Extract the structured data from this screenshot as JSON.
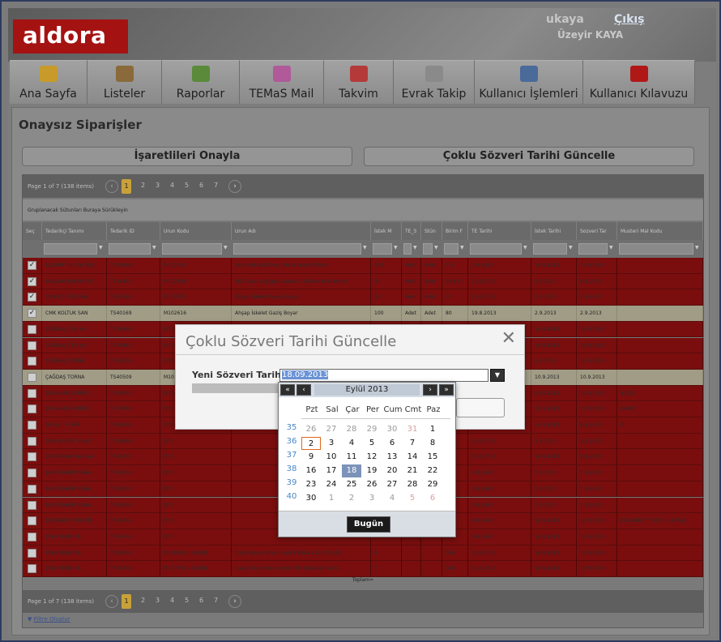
{
  "header": {
    "logo": "aldora",
    "user": "ukaya",
    "logout": "Çıkış",
    "full_name": "Üzeyir KAYA"
  },
  "nav": [
    {
      "label": "Ana Sayfa",
      "icon": "home-icon",
      "color": "#c79a2a"
    },
    {
      "label": "Listeler",
      "icon": "signpost-icon",
      "color": "#8a6a3a"
    },
    {
      "label": "Raporlar",
      "icon": "bar-chart-icon",
      "color": "#5a8a3a"
    },
    {
      "label": "TEMaS Mail",
      "icon": "mail-icon",
      "color": "#b05a9a"
    },
    {
      "label": "Takvim",
      "icon": "calendar-icon",
      "color": "#b43a3a"
    },
    {
      "label": "Evrak Takip",
      "icon": "document-icon",
      "color": "#8a8a8a"
    },
    {
      "label": "Kullanıcı İşlemleri",
      "icon": "user-icon",
      "color": "#4a6a9a"
    },
    {
      "label": "Kullanıcı Kılavuzu",
      "icon": "pdf-icon",
      "color": "#b01818"
    }
  ],
  "page_title": "Onaysız Siparişler",
  "buttons": {
    "approve_selected": "İşaretlileri Onayla",
    "multi_update": "Çoklu Sözveri Tarihi Güncelle"
  },
  "pager": {
    "info": "Page 1 of 7 (138 items)",
    "current": "1",
    "pages": [
      "2",
      "3",
      "4",
      "5",
      "6",
      "7"
    ]
  },
  "group_hint": "Gruplanacak Sütunları Buraya Sürükleyin",
  "columns": [
    "Seç",
    "Tedarikçi Tanımı",
    "Tedarik ID",
    "Urun Kodu",
    "Urun Adı",
    "İstek M",
    "TE_S",
    "Stün",
    "Birim F",
    "TE Tarihi",
    "İstek Tarihi",
    "Sozveri Tar",
    "Musteri Mal Kodu"
  ],
  "rows": [
    {
      "checked": true,
      "selected": false,
      "supplier": "ALTUNAY METAL İNŞ",
      "tid": "TS40499",
      "code": "M102043",
      "name": "Alüm Metal Bölme (M8 Arabesk) Alüm",
      "qty": "250",
      "u1": "Adet",
      "u2": "Adet",
      "price": "1.5",
      "te": "2.9.2013",
      "req": "10.9.2013",
      "sz": "10.9.2013",
      "mm": ""
    },
    {
      "checked": true,
      "selected": false,
      "supplier": "ARSLAN AHŞAP PAZ",
      "tid": "TS40451",
      "code": "M102138",
      "name": "MDF Lam Yağlıgen Sasteni (1800x490x18mm)",
      "qty": "50",
      "u1": "Adet",
      "u2": "Adet",
      "price": "26.691",
      "te": "31.8.2013",
      "req": "9.9.2013",
      "sz": "9.9.2013",
      "mm": ""
    },
    {
      "checked": true,
      "selected": false,
      "supplier": "CMK KOLTUK SAN",
      "tid": "TS40169",
      "code": "M102601",
      "name": "Ahşap İskelet Beyaz Boyar",
      "qty": "30",
      "u1": "Adet",
      "u2": "Adet",
      "price": "70",
      "te": "19.8.2013",
      "req": "2.9.2013",
      "sz": "2.9.2013",
      "mm": ""
    },
    {
      "checked": true,
      "selected": true,
      "supplier": "CMK KOLTUK SAN",
      "tid": "TS40169",
      "code": "M102616",
      "name": "Ahşap İskelet Gaziş Boyar",
      "qty": "100",
      "u1": "Adet",
      "u2": "Adet",
      "price": "80",
      "te": "19.8.2013",
      "req": "2.9.2013",
      "sz": "2.9.2013",
      "mm": ""
    },
    {
      "checked": false,
      "selected": false,
      "supplier": "ÇAĞDAŞ ÇAM AY",
      "tid": "TS40458",
      "code": "M10",
      "name": "",
      "qty": "",
      "u1": "",
      "u2": "",
      "price": "",
      "te": "",
      "req": "16.9.2013",
      "sz": "16.9.2013",
      "mm": ""
    },
    {
      "checked": false,
      "selected": false,
      "supplier": "ÇAĞDAŞ ÇAM AY",
      "tid": "TS40461",
      "code": "M10",
      "name": "",
      "qty": "",
      "u1": "",
      "u2": "",
      "price": "",
      "te": "",
      "req": "16.9.2013",
      "sz": "16.9.2013",
      "mm": ""
    },
    {
      "checked": false,
      "selected": false,
      "supplier": "ÇAĞDAŞ TORNA",
      "tid": "TS40509",
      "code": "M10",
      "name": "",
      "qty": "",
      "u1": "",
      "u2": "",
      "price": "",
      "te": "",
      "req": "5.9.2013",
      "sz": "10.9.2013",
      "mm": ""
    },
    {
      "checked": false,
      "selected": true,
      "supplier": "ÇAĞDAŞ TORNA",
      "tid": "TS40509",
      "code": "M10",
      "name": "",
      "qty": "",
      "u1": "",
      "u2": "",
      "price": "",
      "te": "",
      "req": "10.9.2013",
      "sz": "10.9.2013",
      "mm": ""
    },
    {
      "checked": false,
      "selected": false,
      "supplier": "DEHA MALZEMECİ",
      "tid": "TS40341",
      "code": "M10",
      "name": "",
      "qty": "",
      "u1": "",
      "u2": "",
      "price": "",
      "te": "",
      "req": "6.10.2013",
      "sz": "10.9.2013",
      "mm": "82250"
    },
    {
      "checked": false,
      "selected": false,
      "supplier": "DEHA MALZEMECİ",
      "tid": "TS40383",
      "code": "M10",
      "name": "",
      "qty": "",
      "u1": "",
      "u2": "",
      "price": "",
      "te": "",
      "req": "15.9.2013",
      "sz": "15.9.2013",
      "mm": "66490"
    },
    {
      "checked": false,
      "selected": false,
      "supplier": "DEHA İTH. İHR",
      "tid": "TS40439",
      "code": "M10",
      "name": "",
      "qty": "",
      "u1": "",
      "u2": "",
      "price": "",
      "te": "",
      "req": "14.9.2013",
      "sz": "8.9.2013",
      "mm": "0"
    },
    {
      "checked": false,
      "selected": false,
      "supplier": "DEMAS GEN. PLAST",
      "tid": "TS40448",
      "code": "M10",
      "name": "",
      "qty": "",
      "u1": "",
      "u2": "",
      "price": "",
      "te": "30.8.2013",
      "req": "3.9.2013",
      "sz": "3.9.2013",
      "mm": ""
    },
    {
      "checked": false,
      "selected": false,
      "supplier": "DÜHAŞKAN SANCAK",
      "tid": "TS40370",
      "code": "M10",
      "name": "",
      "qty": "",
      "u1": "",
      "u2": "",
      "price": "",
      "te": "16.8.2013",
      "req": "16.8.2013",
      "sz": "9.9.2013",
      "mm": ""
    },
    {
      "checked": false,
      "selected": false,
      "supplier": "EMA GÖKÜM SANA",
      "tid": "TS40501",
      "code": "M10",
      "name": "",
      "qty": "",
      "u1": "",
      "u2": "",
      "price": "",
      "te": "2.9.2013",
      "req": "7.9.2013",
      "sz": "7.9.2013",
      "mm": ""
    },
    {
      "checked": false,
      "selected": false,
      "supplier": "EMA GÖKÜM SANA",
      "tid": "TS40501",
      "code": "M10",
      "name": "",
      "qty": "",
      "u1": "",
      "u2": "",
      "price": "",
      "te": "2.9.2013",
      "req": "7.9.2013",
      "sz": "7.9.2013",
      "mm": ""
    },
    {
      "checked": false,
      "selected": false,
      "supplier": "EMA GÖKÜM SANA",
      "tid": "TS40500",
      "code": "M10",
      "name": "",
      "qty": "",
      "u1": "",
      "u2": "",
      "price": "",
      "te": "2.9.2013",
      "req": "7.9.2013",
      "sz": "7.9.2013",
      "mm": ""
    },
    {
      "checked": false,
      "selected": false,
      "supplier": "ERCANBEY TEKSTİL",
      "tid": "TS40342",
      "code": "M10",
      "name": "",
      "qty": "",
      "u1": "",
      "u2": "",
      "price": "",
      "te": "9.8.2013",
      "req": "10.8.2013",
      "sz": "10.9.2013",
      "mm": "ERCANBEY TEKSTİL KUMAŞ"
    },
    {
      "checked": false,
      "selected": false,
      "supplier": "ESEN MOBİLYA",
      "tid": "TS40344",
      "code": "M10",
      "name": "",
      "qty": "",
      "u1": "",
      "u2": "",
      "price": "",
      "te": "9.8.2013",
      "req": "10.8.2013",
      "sz": "10.9.2013",
      "mm": ""
    },
    {
      "checked": false,
      "selected": false,
      "supplier": "ESEN MOBİLYA",
      "tid": "TS40346",
      "code": "M120404 / FASON",
      "name": "Gaziş Boyar Silver Renkli 8824 V.12 (KTUGİ)",
      "qty": "8",
      "u1": "",
      "u2": "",
      "price": "340",
      "te": "31.8.2013",
      "req": "10.8.2013",
      "sz": "10.9.2013",
      "mm": ""
    },
    {
      "checked": false,
      "selected": false,
      "supplier": "ESEN MOBİLYA",
      "tid": "TS40346",
      "code": "M177830 / FASON",
      "name": "Gaziş Boyar Max Yaltuk 800 (Kolukgin180)",
      "qty": "7",
      "u1": "",
      "u2": "",
      "price": "340",
      "te": "31.8.2013",
      "req": "10.9.2013",
      "sz": "10.9.2013",
      "mm": ""
    }
  ],
  "totals": "Toplam=",
  "filter_label": "Filtre Oluştur",
  "modal": {
    "title": "Çoklu Sözveri Tarihi Güncelle",
    "close": "✕",
    "label": "Yeni Sözveri Tarihi",
    "value": "18.09.2013"
  },
  "calendar": {
    "month": "Eylül 2013",
    "nav": {
      "prev_year": "«",
      "prev": "‹",
      "next": "›",
      "next_year": "»"
    },
    "day_names": [
      "Pzt",
      "Sal",
      "Çar",
      "Per",
      "Cum",
      "Cmt",
      "Paz"
    ],
    "weeks": [
      {
        "num": "35",
        "days": [
          "26",
          "27",
          "28",
          "29",
          "30",
          "31",
          "1"
        ]
      },
      {
        "num": "36",
        "days": [
          "2",
          "3",
          "4",
          "5",
          "6",
          "7",
          "8"
        ]
      },
      {
        "num": "37",
        "days": [
          "9",
          "10",
          "11",
          "12",
          "13",
          "14",
          "15"
        ]
      },
      {
        "num": "38",
        "days": [
          "16",
          "17",
          "18",
          "19",
          "20",
          "21",
          "22"
        ]
      },
      {
        "num": "39",
        "days": [
          "23",
          "24",
          "25",
          "26",
          "27",
          "28",
          "29"
        ]
      },
      {
        "num": "40",
        "days": [
          "30",
          "1",
          "2",
          "3",
          "4",
          "5",
          "6"
        ]
      }
    ],
    "today_day": "2",
    "selected_day": "18",
    "today_button": "Bugün"
  }
}
